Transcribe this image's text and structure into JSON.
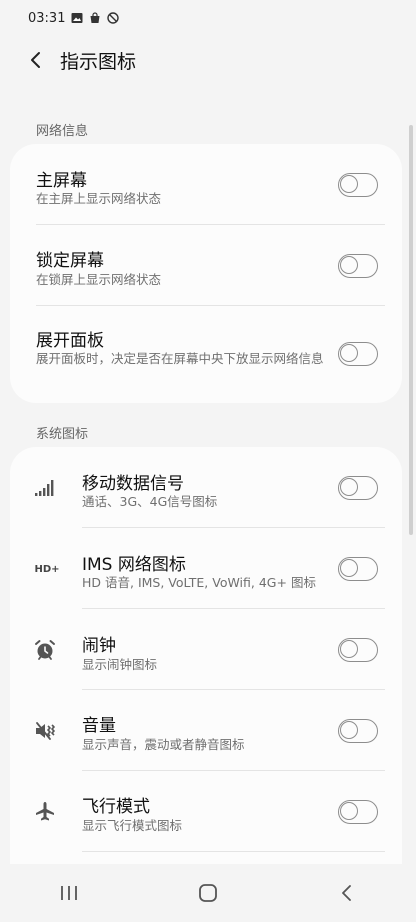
{
  "status_bar": {
    "time": "03:31"
  },
  "appbar": {
    "title": "指示图标"
  },
  "network_section": {
    "label": "网络信息",
    "items": [
      {
        "title": "主屏幕",
        "subtitle": "在主屏上显示网络状态",
        "enabled": false
      },
      {
        "title": "锁定屏幕",
        "subtitle": "在锁屏上显示网络状态",
        "enabled": false
      },
      {
        "title": "展开面板",
        "subtitle": "展开面板时，决定是否在屏幕中央下放显示网络信息",
        "enabled": false
      }
    ]
  },
  "system_section": {
    "label": "系统图标",
    "items": [
      {
        "icon": "signal-icon",
        "title": "移动数据信号",
        "subtitle": "通话、3G、4G信号图标",
        "enabled": false
      },
      {
        "icon": "hd-plus-icon",
        "icon_text": "HD+",
        "title": "IMS 网络图标",
        "subtitle": "HD 语音, IMS, VoLTE, VoWifi, 4G+ 图标",
        "enabled": false
      },
      {
        "icon": "alarm-clock-icon",
        "title": "闹钟",
        "subtitle": "显示闹钟图标",
        "enabled": false
      },
      {
        "icon": "volume-vibrate-icon",
        "title": "音量",
        "subtitle": "显示声音，震动或者静音图标",
        "enabled": false
      },
      {
        "icon": "airplane-icon",
        "title": "飞行模式",
        "subtitle": "显示飞行模式图标",
        "enabled": false
      }
    ]
  }
}
